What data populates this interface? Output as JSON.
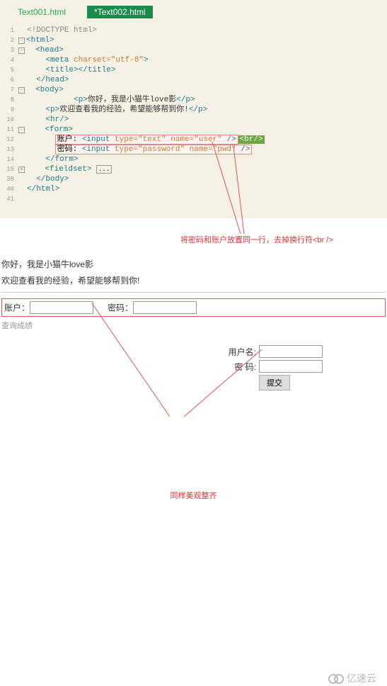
{
  "tabs": [
    {
      "label": "Text001.html"
    },
    {
      "label": "*Text002.html",
      "active": true
    }
  ],
  "code": [
    {
      "n": "1",
      "f": "",
      "h": "<!DOCTYPE html>",
      "cls": "gr"
    },
    {
      "n": "2",
      "f": "-",
      "h": "<html>",
      "cls": "t"
    },
    {
      "n": "3",
      "f": "-",
      "h": "  <head>",
      "cls": "t"
    },
    {
      "n": "4",
      "f": "",
      "h": "    <meta |charset=\"utf-8\"|>",
      "cls": "mix1"
    },
    {
      "n": "5",
      "f": "",
      "h": "    <title></title>",
      "cls": "t"
    },
    {
      "n": "6",
      "f": "",
      "h": "  </head>",
      "cls": "t"
    },
    {
      "n": "7",
      "f": "-",
      "h": "  <body>",
      "cls": "t"
    },
    {
      "n": "8",
      "f": "",
      "h": "          <p>你好，我是小猫牛love影</p>",
      "cls": "mix2"
    },
    {
      "n": "9",
      "f": "",
      "h": "    <p>欢迎查看我的经验，希望能够帮到你!</p>",
      "cls": "mix2"
    },
    {
      "n": "10",
      "f": "",
      "h": "    <hr/>",
      "cls": "t"
    },
    {
      "n": "11",
      "f": "-",
      "h": "    <form>",
      "cls": "t"
    },
    {
      "n": "12",
      "f": "",
      "h": "      [账户: <input type=\"text\" name=\"user\" />]{<br/>}",
      "cls": "hl12"
    },
    {
      "n": "13",
      "f": "",
      "h": "      [密码: <input type=\"password\" name=\"pwd\" />]",
      "cls": "hl13"
    },
    {
      "n": "14",
      "f": "",
      "h": "    </form>",
      "cls": "t"
    },
    {
      "n": "15",
      "f": "+",
      "h": "    <fieldset>[...]",
      "cls": "fs15"
    },
    {
      "n": "38",
      "f": "",
      "h": "  </body>",
      "cls": "t"
    },
    {
      "n": "40",
      "f": "",
      "h": "</html>",
      "cls": "t"
    },
    {
      "n": "41",
      "f": "",
      "h": "",
      "cls": ""
    }
  ],
  "annotation1": "将密码和账户放置同一行，去掉换行符<br />",
  "preview": {
    "line1": "你好，我是小猫牛love影",
    "line2": "欢迎查看我的经验，希望能够帮到你!",
    "user_label": "账户：",
    "pwd_label": "密码：",
    "query": "查询成绩"
  },
  "rform": {
    "user": "用户名:",
    "pwd": "密   码:",
    "submit": "提交"
  },
  "annotation2": "同样美观整齐",
  "logo": "亿速云"
}
